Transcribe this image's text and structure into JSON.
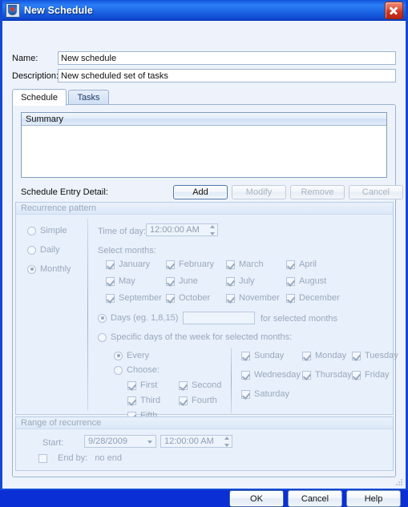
{
  "window": {
    "title": "New Schedule",
    "icon": "app-shield-icon",
    "close_label": "Close",
    "accent": "#1a62e8"
  },
  "form": {
    "name_label": "Name:",
    "name_value": "New schedule",
    "name_placeholder": "",
    "description_label": "Description:",
    "description_value": "New scheduled set of tasks",
    "description_placeholder": ""
  },
  "tabs": [
    {
      "label": "Schedule",
      "active": true
    },
    {
      "label": "Tasks",
      "active": false
    }
  ],
  "summary": {
    "column_header": "Summary",
    "rows": []
  },
  "detail": {
    "label": "Schedule Entry Detail:",
    "buttons": [
      {
        "label": "Add",
        "enabled": true,
        "default": true
      },
      {
        "label": "Modify",
        "enabled": false,
        "default": false
      },
      {
        "label": "Remove",
        "enabled": false,
        "default": false
      },
      {
        "label": "Cancel",
        "enabled": false,
        "default": false
      }
    ]
  },
  "recurrence": {
    "title": "Recurrence pattern",
    "patterns": [
      {
        "label": "Simple",
        "selected": false
      },
      {
        "label": "Daily",
        "selected": false
      },
      {
        "label": "Monthly",
        "selected": true
      }
    ],
    "time_of_day_label": "Time of day:",
    "time_of_day_value": "12:00:00 AM",
    "select_months_label": "Select months:",
    "months": [
      {
        "label": "January",
        "checked": true
      },
      {
        "label": "February",
        "checked": true
      },
      {
        "label": "March",
        "checked": true
      },
      {
        "label": "April",
        "checked": true
      },
      {
        "label": "May",
        "checked": true
      },
      {
        "label": "June",
        "checked": true
      },
      {
        "label": "July",
        "checked": true
      },
      {
        "label": "August",
        "checked": true
      },
      {
        "label": "September",
        "checked": true
      },
      {
        "label": "October",
        "checked": true
      },
      {
        "label": "November",
        "checked": true
      },
      {
        "label": "December",
        "checked": true
      }
    ],
    "days_option_label": "Days (eg. 1,8,15)",
    "days_option_selected": true,
    "days_value": "",
    "days_suffix_label": "for selected months",
    "specific_option_label": "Specific days of the week for selected months:",
    "specific_option_selected": false,
    "every_label": "Every",
    "every_selected": true,
    "choose_label": "Choose:",
    "choose_selected": false,
    "ordinals": [
      {
        "label": "First",
        "checked": true
      },
      {
        "label": "Second",
        "checked": true
      },
      {
        "label": "Third",
        "checked": true
      },
      {
        "label": "Fourth",
        "checked": true
      },
      {
        "label": "Fifth",
        "checked": true
      }
    ],
    "weekdays": [
      {
        "label": "Sunday",
        "checked": true
      },
      {
        "label": "Monday",
        "checked": true
      },
      {
        "label": "Tuesday",
        "checked": true
      },
      {
        "label": "Wednesday",
        "checked": true
      },
      {
        "label": "Thursday",
        "checked": true
      },
      {
        "label": "Friday",
        "checked": true
      },
      {
        "label": "Saturday",
        "checked": true
      }
    ]
  },
  "range": {
    "title": "Range of recurrence",
    "start_label": "Start:",
    "start_date": "9/28/2009",
    "start_time": "12:00:00 AM",
    "end_by_label": "End by:",
    "end_by_checked": false,
    "end_by_value": "no end"
  },
  "footer": {
    "ok_label": "OK",
    "cancel_label": "Cancel",
    "help_label": "Help"
  }
}
